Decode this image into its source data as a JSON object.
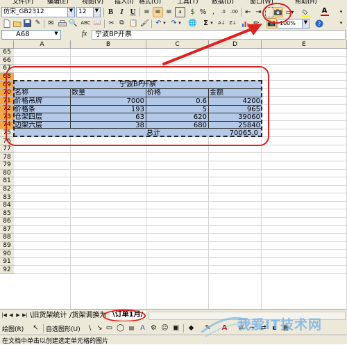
{
  "menu": {
    "items": [
      "文件(F)",
      "编辑(E)",
      "视图(V)",
      "插入(I)",
      "格式(O)",
      "工具(T)",
      "数据(D)",
      "窗口(W)",
      "帮助(H)"
    ]
  },
  "format_toolbar": {
    "font_name": "仿宋_GB2312",
    "font_size": "12",
    "bold": "B",
    "italic": "I",
    "underline": "U",
    "percent": "%",
    "font_color_label": "A"
  },
  "standard_toolbar": {
    "sigma": "Σ",
    "zoom": "100%"
  },
  "formula_bar": {
    "name_box": "A68",
    "fx": "fx",
    "content": "宁波BP开票"
  },
  "grid": {
    "columns": [
      "A",
      "B",
      "C",
      "D",
      "E"
    ],
    "rows": [
      "65",
      "66",
      "67",
      "68",
      "69",
      "70",
      "71",
      "72",
      "73",
      "74",
      "75",
      "76",
      "77",
      "78",
      "79",
      "80",
      "81",
      "82",
      "83",
      "84",
      "85",
      "86",
      "87",
      "88",
      "89",
      "90",
      "91",
      "92"
    ],
    "table_title": "宁波BP开票",
    "headers": [
      "名称",
      "数量",
      "价格",
      "金额"
    ],
    "data_rows": [
      {
        "name": "价格吊牌",
        "qty": "7000",
        "price": "0.6",
        "amount": "4200"
      },
      {
        "name": "价格条",
        "qty": "193",
        "price": "5",
        "amount": "965"
      },
      {
        "name": "仓架四层",
        "qty": "63",
        "price": "620",
        "amount": "39060"
      },
      {
        "name": "边架六层",
        "qty": "38",
        "price": "680",
        "amount": "25840"
      }
    ],
    "total_label": "总计",
    "total_value": "70065.0"
  },
  "sheet_tabs": [
    "旧货架统计",
    "货架调换为",
    "订单1月"
  ],
  "drawing_toolbar": {
    "draw_label": "绘图(R)",
    "autoshape_label": "自选图形(U)"
  },
  "status_bar": {
    "text": "在文档中单击以创建选定单元格的图片"
  },
  "watermark": "我爱IT技术网",
  "colors": {
    "annotation_red": "#e02020",
    "selected_row_header": "#f4a640",
    "table_fill": "#b4c8e8",
    "toolbar_bg": "#ece9d8"
  }
}
